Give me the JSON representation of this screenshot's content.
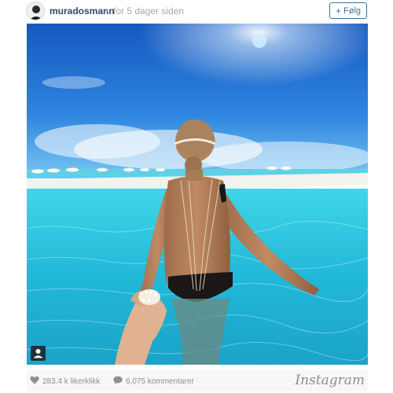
{
  "header": {
    "username": "muradosmann",
    "separator": "•",
    "timestamp": "for 5 dager siden",
    "follow_label": "Følg",
    "follow_icon": "plus-icon"
  },
  "photo": {
    "user_tag_icon": "user-tag-icon"
  },
  "footer": {
    "likes": "283.4 k likerklikk",
    "comments": "6,075 kommentarer",
    "brand": "Instagram",
    "like_icon": "heart-icon",
    "comment_icon": "comment-icon"
  },
  "colors": {
    "link_blue": "#3f729b",
    "username_color": "#2b4b6b",
    "muted_gray": "#8e8e8e",
    "sky_blue": "#1f6fcf",
    "water_turquoise": "#2fc7e0"
  }
}
